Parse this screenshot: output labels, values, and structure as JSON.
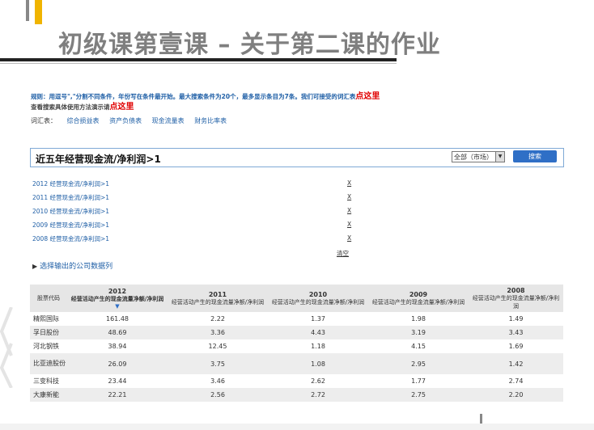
{
  "slide": {
    "title": "初级课第壹课 – 关于第二课的作业"
  },
  "rules": {
    "line1_text": "规则：用逗号\",\"分割不同条件，年份写在条件最开始。最大搜索条件为20个，最多显示条目为7条。我们可接受的词汇表",
    "line1_link": "点这里",
    "line2_text": "查看搜索具体使用方法演示请",
    "line2_link": "点这里"
  },
  "vocab": {
    "label": "词汇表：",
    "links": [
      "综合损益表",
      "资产负债表",
      "现金流量表",
      "财务比率表"
    ]
  },
  "search": {
    "query": "近五年经营现金流/净利润>1",
    "market_select": "全部（市场）",
    "button_label": "搜索"
  },
  "conditions": [
    {
      "text": "2012 经营现金流/净利润>1",
      "remove": "X"
    },
    {
      "text": "2011 经营现金流/净利润>1",
      "remove": "X"
    },
    {
      "text": "2010 经营现金流/净利润>1",
      "remove": "X"
    },
    {
      "text": "2009 经营现金流/净利润>1",
      "remove": "X"
    },
    {
      "text": "2008 经营现金流/净利润>1",
      "remove": "X"
    }
  ],
  "clear_label": "清空",
  "select_columns_label": "选择输出的公司数据列",
  "table": {
    "headers": [
      {
        "year": "",
        "label": "股票代码"
      },
      {
        "year": "2012",
        "label": "经营活动产生的现金流量净额/净利润"
      },
      {
        "year": "2011",
        "label": "经营活动产生的现金流量净额/净利润"
      },
      {
        "year": "2010",
        "label": "经营活动产生的现金流量净额/净利润"
      },
      {
        "year": "2009",
        "label": "经营活动产生的现金流量净额/净利润"
      },
      {
        "year": "2008",
        "label": "经营活动产生的现金流量净额/净利润"
      }
    ],
    "sort_arrow": "▼",
    "rows": [
      [
        "精熙国际",
        "161.48",
        "2.22",
        "1.37",
        "1.98",
        "1.49"
      ],
      [
        "孚日股份",
        "48.69",
        "3.36",
        "4.43",
        "3.19",
        "3.43"
      ],
      [
        "河北钢铁",
        "38.94",
        "12.45",
        "1.18",
        "4.15",
        "1.69"
      ],
      [
        "比亚迪股份",
        "26.09",
        "3.75",
        "1.08",
        "2.95",
        "1.42"
      ],
      [
        "三变科技",
        "23.44",
        "3.46",
        "2.62",
        "1.77",
        "2.74"
      ],
      [
        "大康新能",
        "22.21",
        "2.56",
        "2.72",
        "2.75",
        "2.20"
      ]
    ]
  }
}
